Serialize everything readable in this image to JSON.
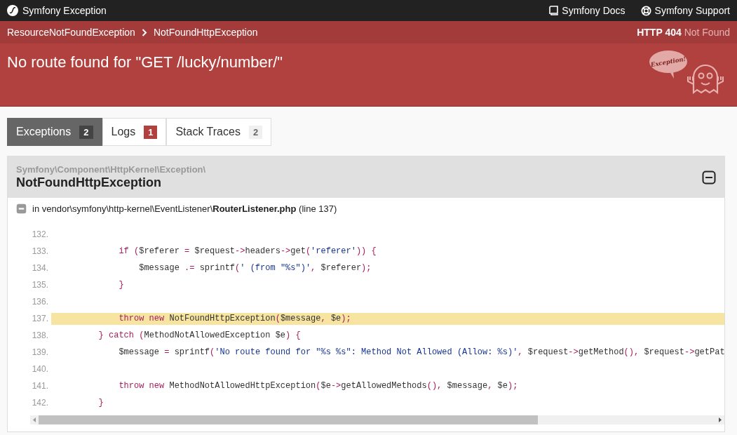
{
  "top_bar": {
    "title": "Symfony Exception",
    "links": [
      {
        "label": "Symfony Docs",
        "kind": "docs"
      },
      {
        "label": "Symfony Support",
        "kind": "support"
      }
    ]
  },
  "breadcrumb": [
    "ResourceNotFoundException",
    "NotFoundHttpException"
  ],
  "status": {
    "code": "HTTP 404",
    "text": "Not Found"
  },
  "message": "No route found for \"GET /lucky/number/\"",
  "mascot": {
    "bubble_text": "Exception!"
  },
  "tabs": [
    {
      "label": "Exceptions",
      "count": "2",
      "kind": "neutral",
      "selected": true
    },
    {
      "label": "Logs",
      "count": "1",
      "kind": "error",
      "selected": false
    },
    {
      "label": "Stack Traces",
      "count": "2",
      "kind": "neutral",
      "selected": false
    }
  ],
  "exception": {
    "namespace": "Symfony\\Component\\HttpKernel\\Exception\\",
    "class": "NotFoundHttpException",
    "expanded": true,
    "trace": {
      "prefix": "in vendor\\symfony\\http-kernel\\EventListener\\",
      "file": "RouterListener.php",
      "line_info": "(line 137)",
      "expanded": true,
      "code": [
        {
          "number": "132.",
          "highlighted": false
        },
        {
          "number": "133.",
          "highlighted": false,
          "tokens": [
            {
              "kind": "keyword",
              "text": "            if"
            },
            {
              "kind": "punct",
              "text": " ("
            },
            {
              "kind": "plain",
              "text": "$referer"
            },
            {
              "kind": "punct",
              "text": " = "
            },
            {
              "kind": "plain",
              "text": "$request"
            },
            {
              "kind": "punct",
              "text": "->"
            },
            {
              "kind": "plain",
              "text": "headers"
            },
            {
              "kind": "punct",
              "text": "->"
            },
            {
              "kind": "plain",
              "text": "get"
            },
            {
              "kind": "punct",
              "text": "("
            },
            {
              "kind": "string",
              "text": "'referer'"
            },
            {
              "kind": "punct",
              "text": ")) {"
            }
          ]
        },
        {
          "number": "134.",
          "highlighted": false,
          "tokens": [
            {
              "kind": "plain",
              "text": "                $message"
            },
            {
              "kind": "punct",
              "text": " .= "
            },
            {
              "kind": "plain",
              "text": "sprintf"
            },
            {
              "kind": "punct",
              "text": "("
            },
            {
              "kind": "string",
              "text": "' (from \"%s\")'"
            },
            {
              "kind": "punct",
              "text": ", "
            },
            {
              "kind": "plain",
              "text": "$referer"
            },
            {
              "kind": "punct",
              "text": ");"
            }
          ]
        },
        {
          "number": "135.",
          "highlighted": false,
          "tokens": [
            {
              "kind": "punct",
              "text": "            }"
            }
          ]
        },
        {
          "number": "136.",
          "highlighted": false
        },
        {
          "number": "137.",
          "highlighted": true,
          "tokens": [
            {
              "kind": "keyword",
              "text": "            throw new"
            },
            {
              "kind": "plain",
              "text": " NotFoundHttpException"
            },
            {
              "kind": "punct",
              "text": "("
            },
            {
              "kind": "plain",
              "text": "$message"
            },
            {
              "kind": "punct",
              "text": ", "
            },
            {
              "kind": "plain",
              "text": "$e"
            },
            {
              "kind": "punct",
              "text": ");"
            }
          ]
        },
        {
          "number": "138.",
          "highlighted": false,
          "tokens": [
            {
              "kind": "punct",
              "text": "        } "
            },
            {
              "kind": "keyword",
              "text": "catch"
            },
            {
              "kind": "punct",
              "text": " ("
            },
            {
              "kind": "plain",
              "text": "MethodNotAllowedException $e"
            },
            {
              "kind": "punct",
              "text": ") {"
            }
          ]
        },
        {
          "number": "139.",
          "highlighted": false,
          "tokens": [
            {
              "kind": "plain",
              "text": "            $message"
            },
            {
              "kind": "punct",
              "text": " = "
            },
            {
              "kind": "plain",
              "text": "sprintf"
            },
            {
              "kind": "punct",
              "text": "("
            },
            {
              "kind": "string",
              "text": "'No route found for \"%s %s\": Method Not Allowed (Allow: %s)'"
            },
            {
              "kind": "punct",
              "text": ", "
            },
            {
              "kind": "plain",
              "text": "$request"
            },
            {
              "kind": "punct",
              "text": "->"
            },
            {
              "kind": "plain",
              "text": "getMethod"
            },
            {
              "kind": "punct",
              "text": "(), "
            },
            {
              "kind": "plain",
              "text": "$request"
            },
            {
              "kind": "punct",
              "text": "->"
            },
            {
              "kind": "plain",
              "text": "getPat"
            }
          ]
        },
        {
          "number": "140.",
          "highlighted": false
        },
        {
          "number": "141.",
          "highlighted": false,
          "tokens": [
            {
              "kind": "keyword",
              "text": "            throw new"
            },
            {
              "kind": "plain",
              "text": " MethodNotAllowedHttpException"
            },
            {
              "kind": "punct",
              "text": "("
            },
            {
              "kind": "plain",
              "text": "$e"
            },
            {
              "kind": "punct",
              "text": "->"
            },
            {
              "kind": "plain",
              "text": "getAllowedMethods"
            },
            {
              "kind": "punct",
              "text": "(), "
            },
            {
              "kind": "plain",
              "text": "$message"
            },
            {
              "kind": "punct",
              "text": ", "
            },
            {
              "kind": "plain",
              "text": "$e"
            },
            {
              "kind": "punct",
              "text": ");"
            }
          ]
        },
        {
          "number": "142.",
          "highlighted": false,
          "tokens": [
            {
              "kind": "punct",
              "text": "        }"
            }
          ]
        }
      ]
    }
  }
}
